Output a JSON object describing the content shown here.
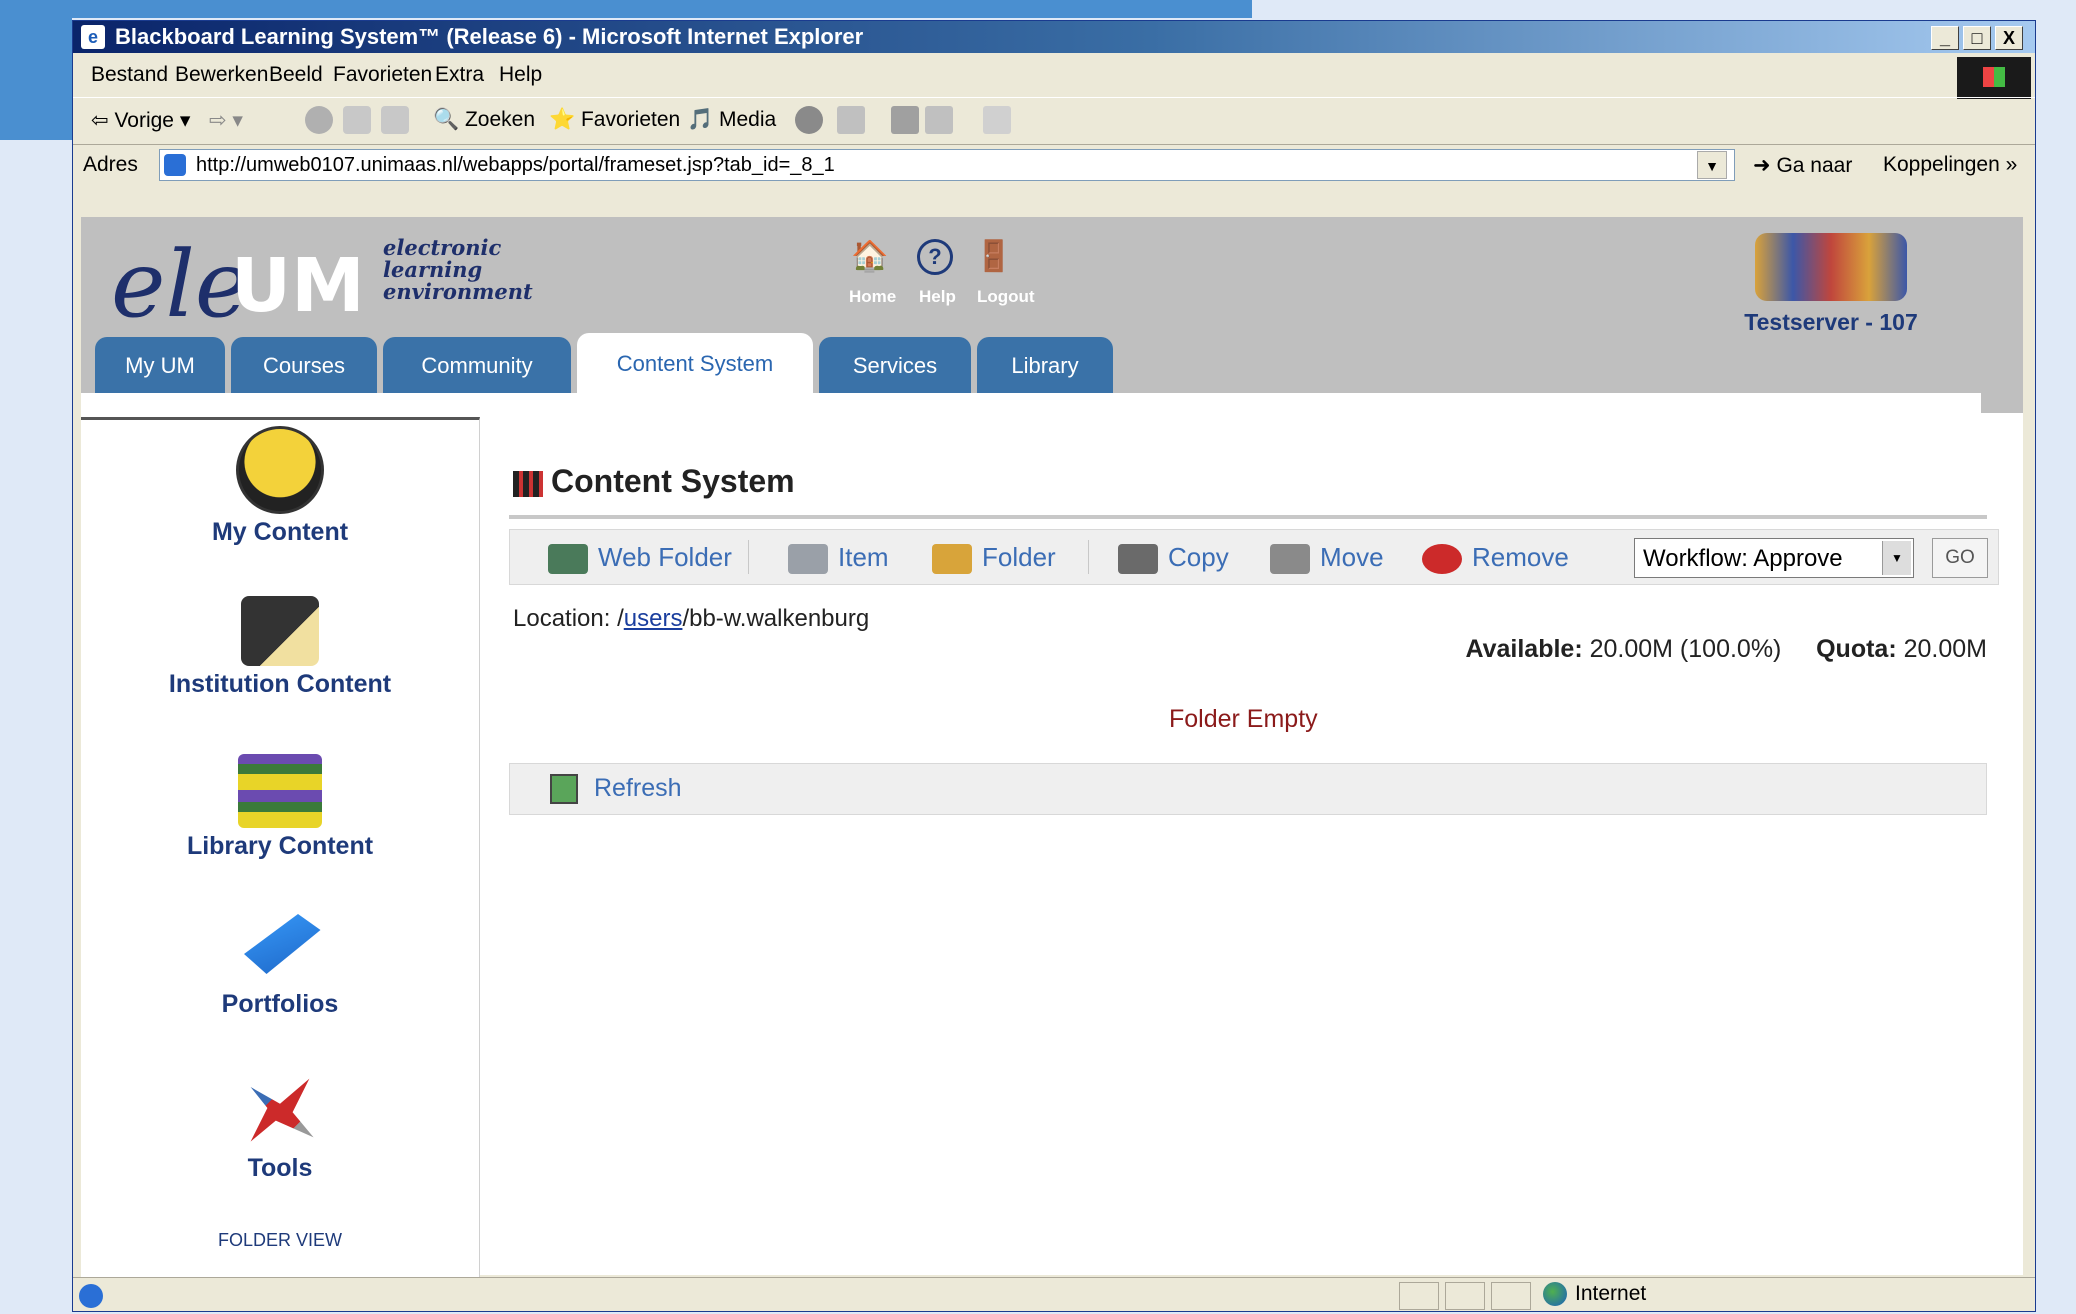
{
  "window": {
    "title": "Blackboard Learning System™ (Release 6) - Microsoft Internet Explorer",
    "buttons": [
      "_",
      "□",
      "X"
    ]
  },
  "menu": [
    "Bestand",
    "Bewerken",
    "Beeld",
    "Favorieten",
    "Extra",
    "Help"
  ],
  "toolbar": {
    "back": "Vorige",
    "search": "Zoeken",
    "favorites": "Favorieten",
    "media": "Media"
  },
  "address": {
    "label": "Adres",
    "url": "http://umweb0107.unimaas.nl/webapps/portal/frameset.jsp?tab_id=_8_1",
    "goto": "Ga naar",
    "links": "Koppelingen"
  },
  "header": {
    "logo_main": "ele",
    "logo_um": "UM",
    "logo_sub_1": "electronic",
    "logo_sub_2": "learning",
    "logo_sub_3": "environment",
    "home": "Home",
    "help": "Help",
    "logout": "Logout",
    "server": "Testserver - 107"
  },
  "tabs": [
    "My UM",
    "Courses",
    "Community",
    "Content System",
    "Services",
    "Library"
  ],
  "active_tab": "Content System",
  "sidebar": {
    "items": [
      "My Content",
      "Institution Content",
      "Library Content",
      "Portfolios",
      "Tools"
    ],
    "folder_view": "FOLDER VIEW"
  },
  "main": {
    "title": "Content System",
    "actions": {
      "web_folder": "Web Folder",
      "item": "Item",
      "folder": "Folder",
      "copy": "Copy",
      "move": "Move",
      "remove": "Remove"
    },
    "workflow_value": "Workflow: Approve",
    "go": "GO",
    "location_label": "Location: /",
    "location_link": "users",
    "location_rest": "/bb-w.walkenburg",
    "available_label": "Available:",
    "available_value": " 20.00M (100.0%)",
    "quota_label": "Quota:",
    "quota_value": " 20.00M",
    "empty": "Folder Empty",
    "refresh": "Refresh"
  },
  "status": {
    "zone": "Internet"
  }
}
